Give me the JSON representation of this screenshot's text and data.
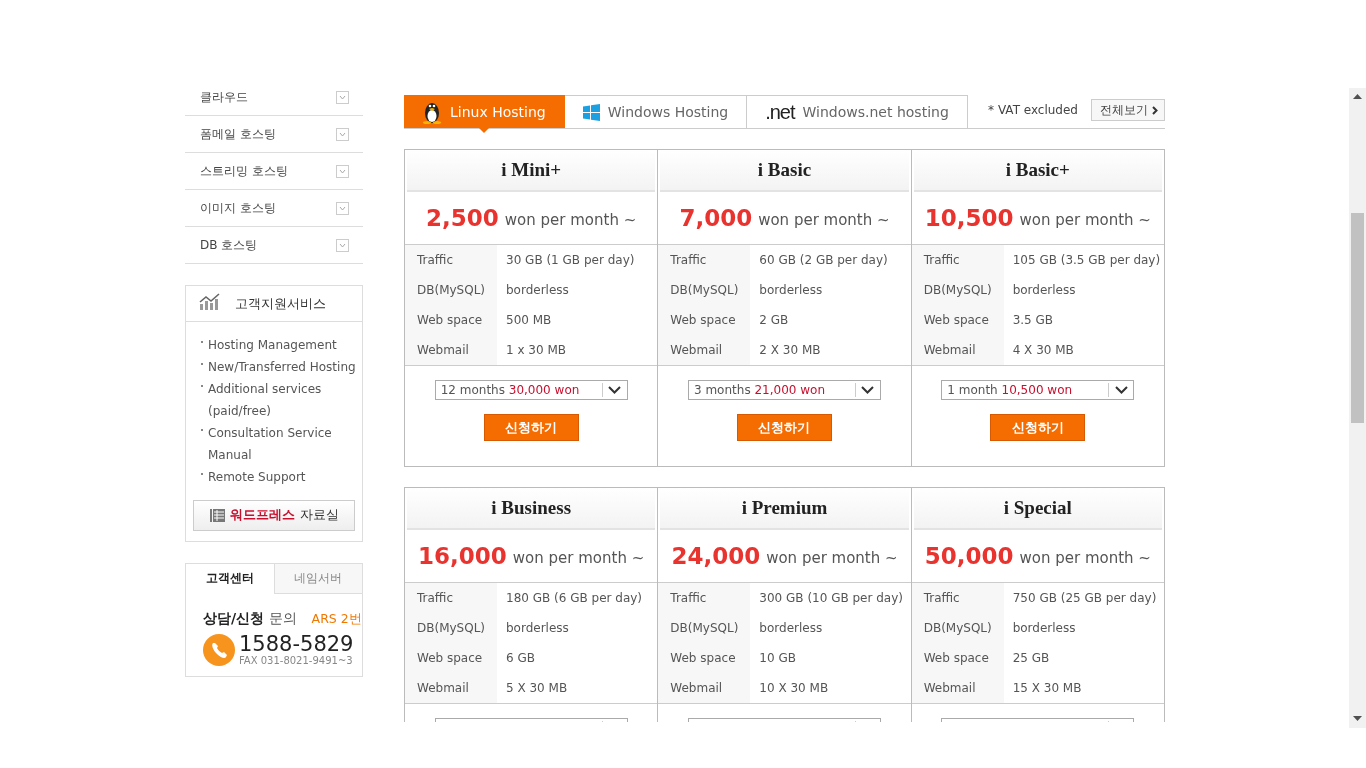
{
  "sidebar": {
    "menu": [
      {
        "label": "클라우드"
      },
      {
        "label": "폼메일 호스팅"
      },
      {
        "label": "스트리밍 호스팅"
      },
      {
        "label": "이미지 호스팅"
      },
      {
        "label": "DB 호스팅"
      }
    ],
    "support": {
      "title": "고객지원서비스",
      "links": [
        "Hosting Management",
        "New/Transferred Hosting",
        "Additional services (paid/free)",
        "Consultation Service Manual",
        "Remote Support"
      ],
      "library_highlight": "워드프레스",
      "library_label": "자료실"
    },
    "center": {
      "tabs": [
        {
          "label": "고객센터",
          "selected": true
        },
        {
          "label": "네임서버",
          "selected": false
        }
      ],
      "inquiry_bold": "상담/신청",
      "inquiry": "문의",
      "ars": "ARS 2번",
      "phone": "1588-5829",
      "fax": "FAX 031-8021-9491~3"
    }
  },
  "tabs": [
    {
      "kind": "linux",
      "label": "Linux Hosting",
      "selected": true
    },
    {
      "kind": "windows",
      "label": "Windows Hosting",
      "selected": false
    },
    {
      "kind": "dotnet",
      "logo": ".net",
      "label": "Windows.net hosting",
      "selected": false
    }
  ],
  "vat_note": "* VAT excluded",
  "view_all": "전체보기",
  "plans": [
    {
      "name": "i Mini+",
      "price": "2,500",
      "unit": "won per month ~",
      "specs": [
        [
          "Traffic",
          "30 GB (1 GB per day)"
        ],
        [
          "DB(MySQL)",
          "borderless"
        ],
        [
          "Web space",
          "500 MB"
        ],
        [
          "Webmail",
          "1 x 30 MB"
        ]
      ],
      "term": "12 months",
      "term_price": "30,000 won",
      "apply": "신청하기"
    },
    {
      "name": "i Basic",
      "price": "7,000",
      "unit": "won per month ~",
      "specs": [
        [
          "Traffic",
          "60 GB (2 GB per day)"
        ],
        [
          "DB(MySQL)",
          "borderless"
        ],
        [
          "Web space",
          "2 GB"
        ],
        [
          "Webmail",
          "2 X 30 MB"
        ]
      ],
      "term": "3 months",
      "term_price": "21,000 won",
      "apply": "신청하기"
    },
    {
      "name": "i Basic+",
      "price": "10,500",
      "unit": "won per month ~",
      "specs": [
        [
          "Traffic",
          "105 GB (3.5 GB per day)"
        ],
        [
          "DB(MySQL)",
          "borderless"
        ],
        [
          "Web space",
          "3.5 GB"
        ],
        [
          "Webmail",
          "4 X 30 MB"
        ]
      ],
      "term": "1 month",
      "term_price": "10,500 won",
      "apply": "신청하기"
    },
    {
      "name": "i Business",
      "price": "16,000",
      "unit": "won per month ~",
      "specs": [
        [
          "Traffic",
          "180 GB (6 GB per day)"
        ],
        [
          "DB(MySQL)",
          "borderless"
        ],
        [
          "Web space",
          "6 GB"
        ],
        [
          "Webmail",
          "5 X 30 MB"
        ]
      ]
    },
    {
      "name": "i Premium",
      "price": "24,000",
      "unit": "won per month ~",
      "specs": [
        [
          "Traffic",
          "300 GB (10 GB per day)"
        ],
        [
          "DB(MySQL)",
          "borderless"
        ],
        [
          "Web space",
          "10 GB"
        ],
        [
          "Webmail",
          "10 X 30 MB"
        ]
      ]
    },
    {
      "name": "i Special",
      "price": "50,000",
      "unit": "won per month ~",
      "specs": [
        [
          "Traffic",
          "750 GB (25 GB per day)"
        ],
        [
          "DB(MySQL)",
          "borderless"
        ],
        [
          "Web space",
          "25 GB"
        ],
        [
          "Webmail",
          "15 X 30 MB"
        ]
      ]
    }
  ]
}
